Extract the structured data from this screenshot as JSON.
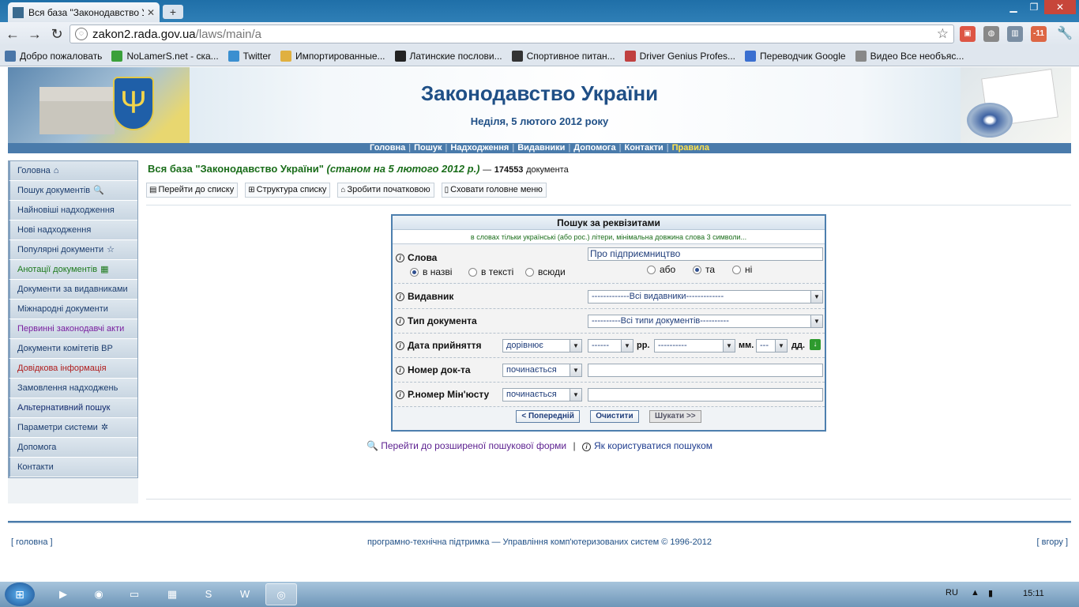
{
  "browser": {
    "tab_title": "Вся база \"Законодавство У",
    "url_host": "zakon2.rada.gov.ua",
    "url_path": "/laws/main/a",
    "bookmarks": [
      {
        "label": "Добро пожаловать",
        "color": "#4a76a8"
      },
      {
        "label": "NoLamerS.net - ска...",
        "color": "#3aa03a"
      },
      {
        "label": "Twitter",
        "color": "#3a8fd0"
      },
      {
        "label": "Импортированные...",
        "color": "#e0b040"
      },
      {
        "label": "Латинские послови...",
        "color": "#222222"
      },
      {
        "label": "Спортивное питан...",
        "color": "#333333"
      },
      {
        "label": "Driver Genius Profes...",
        "color": "#c04040"
      },
      {
        "label": "Переводчик Google",
        "color": "#3a6fd0"
      },
      {
        "label": "Видео Все необъяс...",
        "color": "#888888"
      }
    ],
    "ext_badge": "-11"
  },
  "site": {
    "title": "Законодавство України",
    "date": "Неділя, 5 лютого 2012 року",
    "topnav": [
      "Головна",
      "Пошук",
      "Надходження",
      "Видавники",
      "Допомога",
      "Контакти",
      "Правила"
    ]
  },
  "sidebar": {
    "items": [
      {
        "label": "Головна",
        "icon": "⌂",
        "cls": ""
      },
      {
        "label": "Пошук документів",
        "icon": "🔍",
        "cls": ""
      },
      {
        "label": "Найновіші надходження",
        "icon": "",
        "cls": ""
      },
      {
        "label": "Нові надходження",
        "icon": "",
        "cls": ""
      },
      {
        "label": "Популярні документи",
        "icon": "☆",
        "cls": ""
      },
      {
        "label": "Анотації документів",
        "icon": "▦",
        "cls": "green"
      },
      {
        "label": "Документи за видавниками",
        "icon": "",
        "cls": ""
      },
      {
        "label": "Міжнародні документи",
        "icon": "",
        "cls": ""
      },
      {
        "label": "Первинні законодавчі акти",
        "icon": "",
        "cls": "purple"
      },
      {
        "label": "Документи комітетів ВР",
        "icon": "",
        "cls": ""
      },
      {
        "label": "Довідкова інформація",
        "icon": "",
        "cls": "red"
      },
      {
        "label": "Замовлення надходжень",
        "icon": "",
        "cls": ""
      },
      {
        "label": "Альтернативний пошук",
        "icon": "",
        "cls": "navy"
      },
      {
        "label": "Параметри системи",
        "icon": "✲",
        "cls": ""
      },
      {
        "label": "Допомога",
        "icon": "",
        "cls": ""
      },
      {
        "label": "Контакти",
        "icon": "",
        "cls": ""
      }
    ]
  },
  "main": {
    "crumb_title": "Вся база \"Законодавство України\"",
    "crumb_state": "(станом на 5 лютого 2012 р.)",
    "crumb_dash": "—",
    "doc_count": "174553",
    "doc_word": "документа",
    "toolbar": [
      "Перейти до списку",
      "Структура списку",
      "Зробити початковою",
      "Сховати головне меню"
    ]
  },
  "form": {
    "title": "Пошук за реквізитами",
    "hint": "в словах тільки українські (або рос.) літери, мінімальна довжина слова 3 символи...",
    "words_label": "Слова",
    "words_value": "Про підприємництво",
    "scope_options": [
      "в назві",
      "в тексті",
      "всюди"
    ],
    "logic_options": [
      "або",
      "та",
      "ні"
    ],
    "publisher_label": "Видавник",
    "publisher_value": "-------------Всі видавники-------------",
    "doctype_label": "Тип документа",
    "doctype_value": "----------Всі типи документів----------",
    "date_label": "Дата прийняття",
    "date_op": "дорівнює",
    "year_value": "------",
    "year_unit": "рр.",
    "month_value": "----------",
    "month_unit": "мм.",
    "day_value": "---",
    "day_unit": "дд.",
    "number_label": "Номер док-та",
    "number_op": "починається",
    "regnum_label": "Р.номер Мін'юсту",
    "regnum_op": "починається",
    "btn_prev": "< Попередній",
    "btn_clear": "Очистити",
    "btn_search": "Шукати >>"
  },
  "links": {
    "advanced": "Перейти до розширеної пошукової форми",
    "pipe": "|",
    "howto": "Як користуватися пошуком"
  },
  "footer": {
    "left": "[ головна ]",
    "center": "програмно-технічна підтримка — Управління комп'ютеризованих систем © 1996-2012",
    "right": "[ вгору ]"
  },
  "taskbar": {
    "lang": "RU",
    "time": "15:11"
  }
}
